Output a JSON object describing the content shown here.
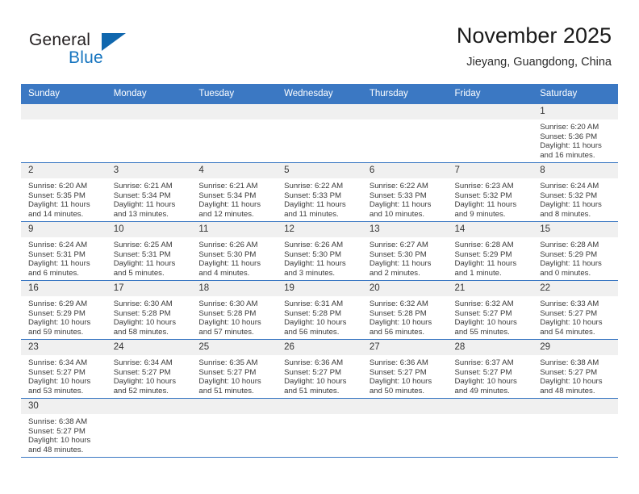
{
  "brand": {
    "name_part1": "General",
    "name_part2": "Blue",
    "triangle_color": "#1067ae",
    "blue_color": "#1574bf"
  },
  "header": {
    "title": "November 2025",
    "subtitle": "Jieyang, Guangdong, China"
  },
  "theme": {
    "header_bg": "#3b78c3",
    "daynum_bg": "#f0f0f0",
    "grid_line": "#3b78c3"
  },
  "weekday_headers": [
    "Sunday",
    "Monday",
    "Tuesday",
    "Wednesday",
    "Thursday",
    "Friday",
    "Saturday"
  ],
  "labels": {
    "sunrise": "Sunrise:",
    "sunset": "Sunset:",
    "daylight": "Daylight:"
  },
  "weeks": [
    [
      {
        "day": "",
        "empty": true,
        "line1": "",
        "line2": "",
        "line3": "",
        "line4": ""
      },
      {
        "day": "",
        "empty": true,
        "line1": "",
        "line2": "",
        "line3": "",
        "line4": ""
      },
      {
        "day": "",
        "empty": true,
        "line1": "",
        "line2": "",
        "line3": "",
        "line4": ""
      },
      {
        "day": "",
        "empty": true,
        "line1": "",
        "line2": "",
        "line3": "",
        "line4": ""
      },
      {
        "day": "",
        "empty": true,
        "line1": "",
        "line2": "",
        "line3": "",
        "line4": ""
      },
      {
        "day": "",
        "empty": true,
        "line1": "",
        "line2": "",
        "line3": "",
        "line4": ""
      },
      {
        "day": "1",
        "empty": false,
        "line1": "Sunrise: 6:20 AM",
        "line2": "Sunset: 5:36 PM",
        "line3": "Daylight: 11 hours",
        "line4": "and 16 minutes."
      }
    ],
    [
      {
        "day": "2",
        "empty": false,
        "line1": "Sunrise: 6:20 AM",
        "line2": "Sunset: 5:35 PM",
        "line3": "Daylight: 11 hours",
        "line4": "and 14 minutes."
      },
      {
        "day": "3",
        "empty": false,
        "line1": "Sunrise: 6:21 AM",
        "line2": "Sunset: 5:34 PM",
        "line3": "Daylight: 11 hours",
        "line4": "and 13 minutes."
      },
      {
        "day": "4",
        "empty": false,
        "line1": "Sunrise: 6:21 AM",
        "line2": "Sunset: 5:34 PM",
        "line3": "Daylight: 11 hours",
        "line4": "and 12 minutes."
      },
      {
        "day": "5",
        "empty": false,
        "line1": "Sunrise: 6:22 AM",
        "line2": "Sunset: 5:33 PM",
        "line3": "Daylight: 11 hours",
        "line4": "and 11 minutes."
      },
      {
        "day": "6",
        "empty": false,
        "line1": "Sunrise: 6:22 AM",
        "line2": "Sunset: 5:33 PM",
        "line3": "Daylight: 11 hours",
        "line4": "and 10 minutes."
      },
      {
        "day": "7",
        "empty": false,
        "line1": "Sunrise: 6:23 AM",
        "line2": "Sunset: 5:32 PM",
        "line3": "Daylight: 11 hours",
        "line4": "and 9 minutes."
      },
      {
        "day": "8",
        "empty": false,
        "line1": "Sunrise: 6:24 AM",
        "line2": "Sunset: 5:32 PM",
        "line3": "Daylight: 11 hours",
        "line4": "and 8 minutes."
      }
    ],
    [
      {
        "day": "9",
        "empty": false,
        "line1": "Sunrise: 6:24 AM",
        "line2": "Sunset: 5:31 PM",
        "line3": "Daylight: 11 hours",
        "line4": "and 6 minutes."
      },
      {
        "day": "10",
        "empty": false,
        "line1": "Sunrise: 6:25 AM",
        "line2": "Sunset: 5:31 PM",
        "line3": "Daylight: 11 hours",
        "line4": "and 5 minutes."
      },
      {
        "day": "11",
        "empty": false,
        "line1": "Sunrise: 6:26 AM",
        "line2": "Sunset: 5:30 PM",
        "line3": "Daylight: 11 hours",
        "line4": "and 4 minutes."
      },
      {
        "day": "12",
        "empty": false,
        "line1": "Sunrise: 6:26 AM",
        "line2": "Sunset: 5:30 PM",
        "line3": "Daylight: 11 hours",
        "line4": "and 3 minutes."
      },
      {
        "day": "13",
        "empty": false,
        "line1": "Sunrise: 6:27 AM",
        "line2": "Sunset: 5:30 PM",
        "line3": "Daylight: 11 hours",
        "line4": "and 2 minutes."
      },
      {
        "day": "14",
        "empty": false,
        "line1": "Sunrise: 6:28 AM",
        "line2": "Sunset: 5:29 PM",
        "line3": "Daylight: 11 hours",
        "line4": "and 1 minute."
      },
      {
        "day": "15",
        "empty": false,
        "line1": "Sunrise: 6:28 AM",
        "line2": "Sunset: 5:29 PM",
        "line3": "Daylight: 11 hours",
        "line4": "and 0 minutes."
      }
    ],
    [
      {
        "day": "16",
        "empty": false,
        "line1": "Sunrise: 6:29 AM",
        "line2": "Sunset: 5:29 PM",
        "line3": "Daylight: 10 hours",
        "line4": "and 59 minutes."
      },
      {
        "day": "17",
        "empty": false,
        "line1": "Sunrise: 6:30 AM",
        "line2": "Sunset: 5:28 PM",
        "line3": "Daylight: 10 hours",
        "line4": "and 58 minutes."
      },
      {
        "day": "18",
        "empty": false,
        "line1": "Sunrise: 6:30 AM",
        "line2": "Sunset: 5:28 PM",
        "line3": "Daylight: 10 hours",
        "line4": "and 57 minutes."
      },
      {
        "day": "19",
        "empty": false,
        "line1": "Sunrise: 6:31 AM",
        "line2": "Sunset: 5:28 PM",
        "line3": "Daylight: 10 hours",
        "line4": "and 56 minutes."
      },
      {
        "day": "20",
        "empty": false,
        "line1": "Sunrise: 6:32 AM",
        "line2": "Sunset: 5:28 PM",
        "line3": "Daylight: 10 hours",
        "line4": "and 56 minutes."
      },
      {
        "day": "21",
        "empty": false,
        "line1": "Sunrise: 6:32 AM",
        "line2": "Sunset: 5:27 PM",
        "line3": "Daylight: 10 hours",
        "line4": "and 55 minutes."
      },
      {
        "day": "22",
        "empty": false,
        "line1": "Sunrise: 6:33 AM",
        "line2": "Sunset: 5:27 PM",
        "line3": "Daylight: 10 hours",
        "line4": "and 54 minutes."
      }
    ],
    [
      {
        "day": "23",
        "empty": false,
        "line1": "Sunrise: 6:34 AM",
        "line2": "Sunset: 5:27 PM",
        "line3": "Daylight: 10 hours",
        "line4": "and 53 minutes."
      },
      {
        "day": "24",
        "empty": false,
        "line1": "Sunrise: 6:34 AM",
        "line2": "Sunset: 5:27 PM",
        "line3": "Daylight: 10 hours",
        "line4": "and 52 minutes."
      },
      {
        "day": "25",
        "empty": false,
        "line1": "Sunrise: 6:35 AM",
        "line2": "Sunset: 5:27 PM",
        "line3": "Daylight: 10 hours",
        "line4": "and 51 minutes."
      },
      {
        "day": "26",
        "empty": false,
        "line1": "Sunrise: 6:36 AM",
        "line2": "Sunset: 5:27 PM",
        "line3": "Daylight: 10 hours",
        "line4": "and 51 minutes."
      },
      {
        "day": "27",
        "empty": false,
        "line1": "Sunrise: 6:36 AM",
        "line2": "Sunset: 5:27 PM",
        "line3": "Daylight: 10 hours",
        "line4": "and 50 minutes."
      },
      {
        "day": "28",
        "empty": false,
        "line1": "Sunrise: 6:37 AM",
        "line2": "Sunset: 5:27 PM",
        "line3": "Daylight: 10 hours",
        "line4": "and 49 minutes."
      },
      {
        "day": "29",
        "empty": false,
        "line1": "Sunrise: 6:38 AM",
        "line2": "Sunset: 5:27 PM",
        "line3": "Daylight: 10 hours",
        "line4": "and 48 minutes."
      }
    ],
    [
      {
        "day": "30",
        "empty": false,
        "line1": "Sunrise: 6:38 AM",
        "line2": "Sunset: 5:27 PM",
        "line3": "Daylight: 10 hours",
        "line4": "and 48 minutes."
      },
      {
        "day": "",
        "empty": true,
        "line1": "",
        "line2": "",
        "line3": "",
        "line4": ""
      },
      {
        "day": "",
        "empty": true,
        "line1": "",
        "line2": "",
        "line3": "",
        "line4": ""
      },
      {
        "day": "",
        "empty": true,
        "line1": "",
        "line2": "",
        "line3": "",
        "line4": ""
      },
      {
        "day": "",
        "empty": true,
        "line1": "",
        "line2": "",
        "line3": "",
        "line4": ""
      },
      {
        "day": "",
        "empty": true,
        "line1": "",
        "line2": "",
        "line3": "",
        "line4": ""
      },
      {
        "day": "",
        "empty": true,
        "line1": "",
        "line2": "",
        "line3": "",
        "line4": ""
      }
    ]
  ]
}
